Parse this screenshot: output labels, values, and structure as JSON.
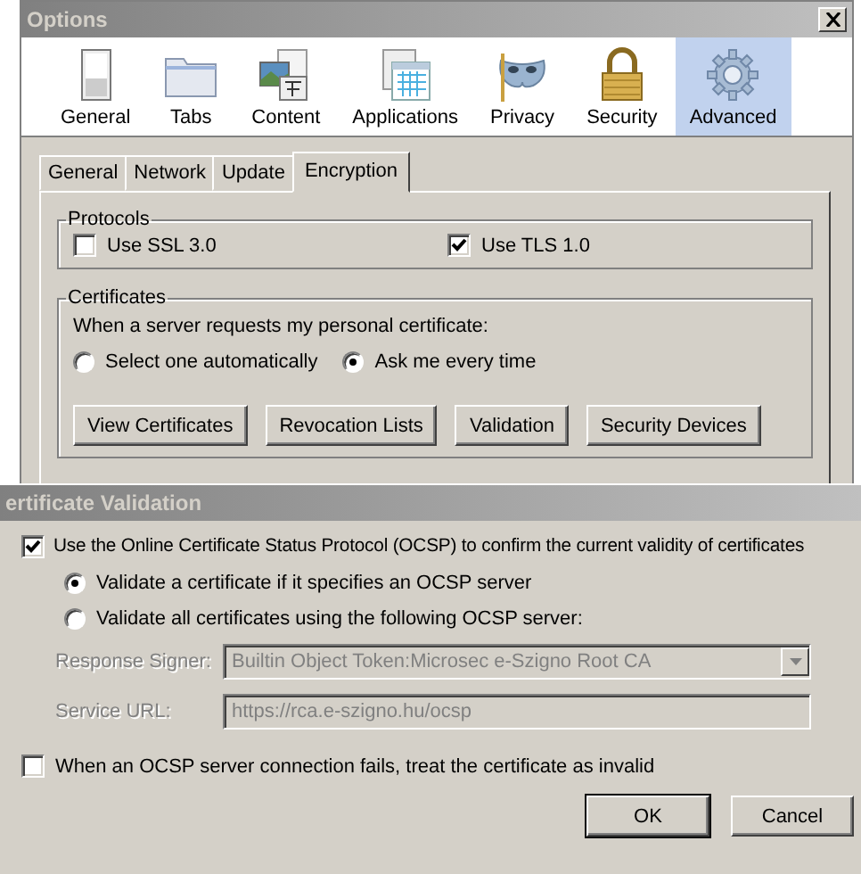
{
  "options_window": {
    "title": "Options",
    "toolbar": [
      {
        "label": "General",
        "selected": false
      },
      {
        "label": "Tabs",
        "selected": false
      },
      {
        "label": "Content",
        "selected": false
      },
      {
        "label": "Applications",
        "selected": false
      },
      {
        "label": "Privacy",
        "selected": false
      },
      {
        "label": "Security",
        "selected": false
      },
      {
        "label": "Advanced",
        "selected": true
      }
    ],
    "tabs": [
      {
        "label": "General",
        "selected": false
      },
      {
        "label": "Network",
        "selected": false
      },
      {
        "label": "Update",
        "selected": false
      },
      {
        "label": "Encryption",
        "selected": true
      }
    ],
    "protocols": {
      "title": "Protocols",
      "options": [
        {
          "label": "Use SSL 3.0",
          "checked": false
        },
        {
          "label": "Use TLS 1.0",
          "checked": true
        }
      ]
    },
    "certificates": {
      "title": "Certificates",
      "prompt": "When a server requests my personal certificate:",
      "choices": [
        {
          "label": "Select one automatically",
          "selected": false
        },
        {
          "label": "Ask me every time",
          "selected": true
        }
      ],
      "buttons": [
        "View Certificates",
        "Revocation Lists",
        "Validation",
        "Security Devices"
      ]
    }
  },
  "validation_dialog": {
    "title": "ertificate Validation",
    "use_ocsp": {
      "label": "Use the Online Certificate Status Protocol (OCSP) to confirm the current validity of certificates",
      "checked": true
    },
    "modes": [
      {
        "label": "Validate a certificate if it specifies an OCSP server",
        "selected": true
      },
      {
        "label": "Validate all certificates using the following OCSP server:",
        "selected": false
      }
    ],
    "fields": [
      {
        "kind": "dropdown",
        "label": "Response Signer:",
        "value": "Builtin Object Token:Microsec e-Szigno Root CA",
        "disabled": true
      },
      {
        "kind": "text",
        "label": "Service URL:",
        "value": "https://rca.e-szigno.hu/ocsp",
        "disabled": true
      }
    ],
    "fail_invalid": {
      "label": "When an OCSP server connection fails, treat the certificate as invalid",
      "checked": false
    },
    "buttons": [
      "OK",
      "Cancel"
    ]
  }
}
